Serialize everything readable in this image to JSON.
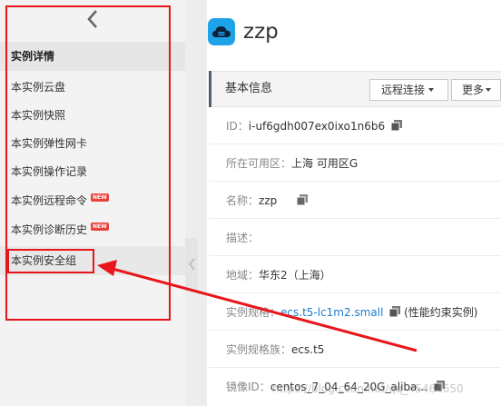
{
  "sidebar": {
    "header": "实例详情",
    "items": [
      {
        "label": "本实例云盘",
        "badge": ""
      },
      {
        "label": "本实例快照",
        "badge": ""
      },
      {
        "label": "本实例弹性网卡",
        "badge": ""
      },
      {
        "label": "本实例操作记录",
        "badge": ""
      },
      {
        "label": "本实例远程命令",
        "badge": "NEW"
      },
      {
        "label": "本实例诊断历史",
        "badge": "NEW"
      },
      {
        "label": "本实例安全组",
        "badge": ""
      }
    ]
  },
  "instance": {
    "name": "zzp"
  },
  "info": {
    "title": "基本信息",
    "remote_connect": "远程连接",
    "more": "更多"
  },
  "fields": {
    "id_label": "ID：",
    "id_value": "i-uf6gdh007ex0ixo1n6b6",
    "zone_label": "所在可用区：",
    "zone_value": "上海 可用区G",
    "name_label": "名称：",
    "name_value": "zzp",
    "desc_label": "描述：",
    "desc_value": "",
    "region_label": "地域：",
    "region_value": "华东2（上海）",
    "spec_label": "实例规格：",
    "spec_value": "ecs.t5-lc1m2.small",
    "spec_note": "(性能约束实例)",
    "family_label": "实例规格族：",
    "family_value": "ecs.t5",
    "image_label": "镜像ID：",
    "image_value": "centos_7_04_64_20G_aliba..."
  },
  "watermark": "https://blog.csdn.net/qq_45464650",
  "colors": {
    "annotation_red": "#e8151b",
    "link_blue": "#1b7bd3",
    "cloud_icon_bg": "#1fa3e8",
    "badge_red": "#e8413c"
  }
}
